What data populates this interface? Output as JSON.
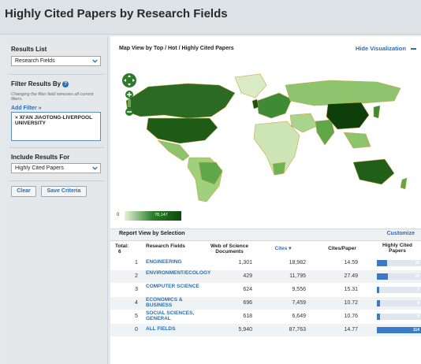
{
  "page": {
    "title": "Highly Cited Papers by Research Fields"
  },
  "sidebar": {
    "results_list_label": "Results List",
    "results_list_value": "Research Fields",
    "filter_label": "Filter Results By",
    "filter_hint": "Changing the filter field removes all current filters.",
    "add_filter": "Add Filter »",
    "filter_chip": "× XI'AN JIAOTONG-LIVERPOOL UNIVERSITY",
    "include_label": "Include Results For",
    "include_value": "Highly Cited Papers",
    "clear_label": "Clear",
    "save_label": "Save Criteria"
  },
  "map": {
    "title": "Map View by Top / Hot / Highly Cited Papers",
    "hide_label": "Hide Visualization",
    "legend_min": "0",
    "legend_max": "78,147",
    "accent_dark": "#1f5f1a",
    "accent_light": "#cfe6b8"
  },
  "report": {
    "title": "Report View by Selection",
    "customize": "Customize",
    "headers": {
      "total": "Total:",
      "total_count": "6",
      "field": "Research Fields",
      "wos": "Web of Science Documents",
      "cites": "Cites ▾",
      "cites_per_paper": "Cites/Paper",
      "hcp": "Highly Cited Papers"
    },
    "rows": [
      {
        "rank": "1",
        "field": "ENGINEERING",
        "wos": "1,301",
        "cites": "18,982",
        "cpp": "14.59",
        "hcp": "26",
        "hcp_frac": 0.23
      },
      {
        "rank": "2",
        "field": "ENVIRONMENT/ECOLOGY",
        "wos": "429",
        "cites": "11,795",
        "cpp": "27.49",
        "hcp": "29",
        "hcp_frac": 0.25
      },
      {
        "rank": "3",
        "field": "COMPUTER SCIENCE",
        "wos": "624",
        "cites": "9,556",
        "cpp": "15.31",
        "hcp": "7",
        "hcp_frac": 0.06
      },
      {
        "rank": "4",
        "field": "ECONOMICS & BUSINESS",
        "wos": "696",
        "cites": "7,459",
        "cpp": "10.72",
        "hcp": "9",
        "hcp_frac": 0.08
      },
      {
        "rank": "5",
        "field": "SOCIAL SCIENCES, GENERAL",
        "wos": "618",
        "cites": "6,649",
        "cpp": "10.76",
        "hcp": "9",
        "hcp_frac": 0.08
      },
      {
        "rank": "0",
        "field": "ALL FIELDS",
        "wos": "5,940",
        "cites": "87,763",
        "cpp": "14.77",
        "hcp": "114",
        "hcp_frac": 1.0
      }
    ]
  }
}
